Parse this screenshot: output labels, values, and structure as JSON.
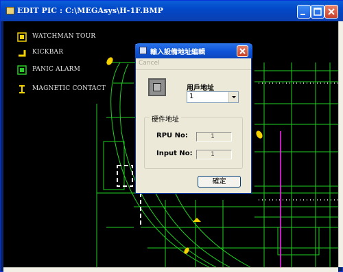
{
  "window": {
    "title": "EDIT PIC : C:\\MEGAsys\\H-1F.BMP"
  },
  "legend": [
    {
      "label": "WATCHMAN TOUR",
      "icon": "watchman-tour-icon",
      "color": "#f5d100"
    },
    {
      "label": "KICKBAR",
      "icon": "kickbar-icon",
      "color": "#f5d100"
    },
    {
      "label": "PANIC ALARM",
      "icon": "panic-alarm-icon",
      "color": "#22d022"
    },
    {
      "label": "MAGNETIC CONTACT",
      "icon": "magnetic-contact-icon",
      "color": "#f5d100"
    }
  ],
  "dialog": {
    "title": "輸入設備地址編輯",
    "menu_cancel": "Cancel",
    "user_address_label": "用戶地址",
    "user_address_value": "1",
    "hardware_group_label": "硬件地址",
    "rpu_label": "RPU No:",
    "rpu_value": "1",
    "input_label": "Input No:",
    "input_value": "1",
    "ok_label": "確定"
  },
  "colors": {
    "floorplan_line": "#1fd11f",
    "highlight": "#ff22ff",
    "titlebar": "#0a5fd8"
  }
}
